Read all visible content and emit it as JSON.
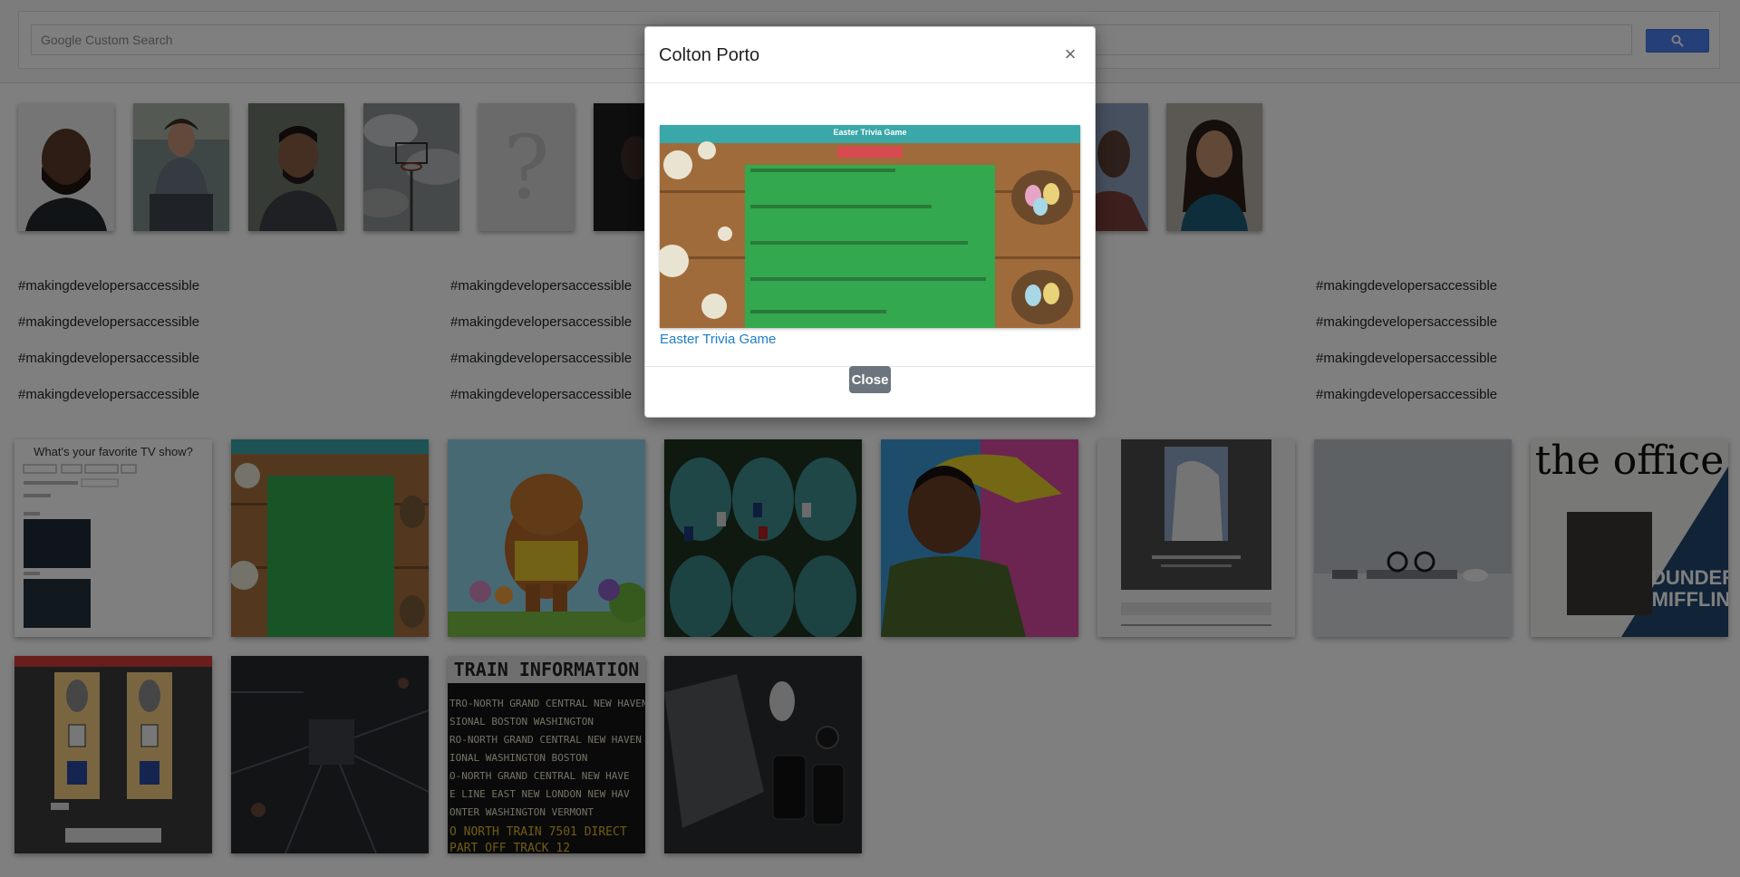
{
  "search": {
    "placeholder": "Google Custom Search",
    "button_icon": "search-icon"
  },
  "avatars": [
    {
      "name": "avatar-bearded-man"
    },
    {
      "name": "avatar-man-sitting"
    },
    {
      "name": "avatar-smiling-man"
    },
    {
      "name": "avatar-basketball-hoop"
    },
    {
      "name": "avatar-question-mark"
    },
    {
      "name": "avatar-dark-portrait"
    },
    {
      "name": "avatar-partial-portrait"
    },
    {
      "name": "avatar-woman"
    }
  ],
  "hashtags": {
    "col1": [
      "#makingdevelopersaccessible",
      "#makingdevelopersaccessible",
      "#makingdevelopersaccessible",
      "#makingdevelopersaccessible"
    ],
    "col2": [
      "#makingdevelopersaccessible",
      "#makingdevelopersaccessible",
      "#makingdevelopersaccessible",
      "#makingdevelopersaccessible"
    ],
    "col3": [
      "#makingdevelopersaccessible",
      "#makingdevelopersaccessible",
      "#makingdevelopersaccessible",
      "#makingdevelopersaccessible"
    ]
  },
  "tiles": {
    "tv_show_title": "What's your favorite TV show?",
    "office_title": "the office",
    "dunder": "DUNDER",
    "mifflin": "MIFFLIN,",
    "train_header": "TRAIN  INFORMATION",
    "train_rows": [
      "TRO-NORTH   GRAND CENTRAL  NEW HAVEN",
      "SIONAL      BOSTON         WASHINGTON",
      "RO-NORTH    GRAND CENTRAL  NEW HAVEN",
      "IONAL       WASHINGTON     BOSTON",
      "O-NORTH     GRAND CENTRAL  NEW HAVE",
      "E LINE EAST NEW LONDON     NEW HAV",
      "ONTER       WASHINGTON     VERMONT",
      "O NORTH TRAIN 7501 DIRECT",
      "PART OFF TRACK 12"
    ]
  },
  "modal": {
    "title": "Colton Porto",
    "close_x": "×",
    "preview_title": "Easter Trivia Game",
    "link_text": "Easter Trivia Game",
    "close_button": "Close"
  },
  "colors": {
    "link": "#1e7ec8",
    "close_button": "#6c757d",
    "search_button": "#4a7ff0",
    "backdrop": "rgba(0,0,0,0.5)"
  }
}
